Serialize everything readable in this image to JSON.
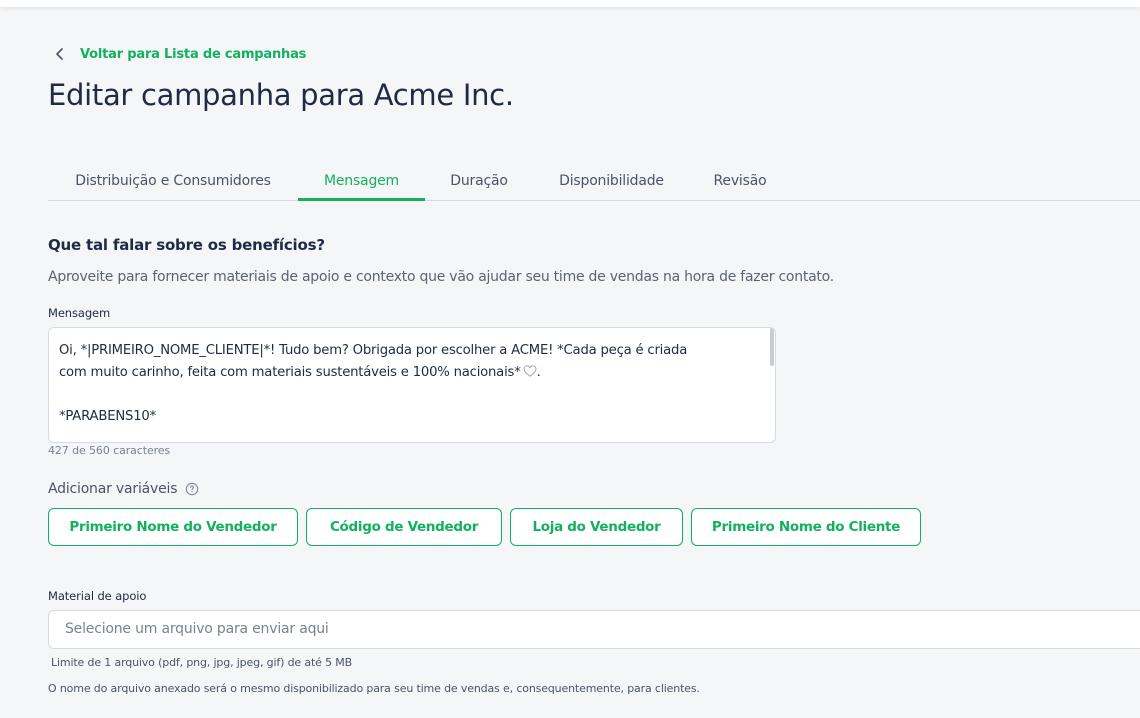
{
  "back_link": {
    "label": "Voltar para Lista de campanhas",
    "icon": "chevron-left-icon"
  },
  "page_title": "Editar campanha para Acme Inc.",
  "tabs": [
    {
      "label": "Distribuição e Consumidores",
      "active": false
    },
    {
      "label": "Mensagem",
      "active": true
    },
    {
      "label": "Duração",
      "active": false
    },
    {
      "label": "Disponibilidade",
      "active": false
    },
    {
      "label": "Revisão",
      "active": false
    }
  ],
  "section": {
    "title": "Que tal falar sobre os benefícios?",
    "description": "Aproveite para fornecer materiais de apoio e contexto que vão ajudar seu time de vendas na hora de fazer contato."
  },
  "message": {
    "label": "Mensagem",
    "line1": "Oi, *|PRIMEIRO_NOME_CLIENTE|*! Tudo bem? Obrigada por escolher a ACME! *Cada peça é criada",
    "line2": "com muito carinho, feita com materiais sustentáveis e 100% nacionais*",
    "line2_end": ".",
    "line3": "*PARABENS10*",
    "counter": "427 de 560 caracteres"
  },
  "variables": {
    "label": "Adicionar variáveis",
    "help_icon": "help-circle-icon",
    "buttons": [
      "Primeiro Nome do Vendedor",
      "Código de Vendedor",
      "Loja do Vendedor",
      "Primeiro Nome do Cliente"
    ]
  },
  "support_material": {
    "label": "Material de apoio",
    "placeholder": "Selecione um arquivo para enviar aqui",
    "limit_hint": "Limite de 1 arquivo (pdf, png, jpg, jpeg, gif) de até 5 MB",
    "name_hint": "O nome do arquivo anexado será o mesmo disponibilizado para seu time de vendas e, consequentemente, para clientes."
  },
  "colors": {
    "accent": "#12b15e",
    "text_primary": "#1f2a44",
    "background": "#f5f6f8",
    "border": "#d7dbe1"
  }
}
